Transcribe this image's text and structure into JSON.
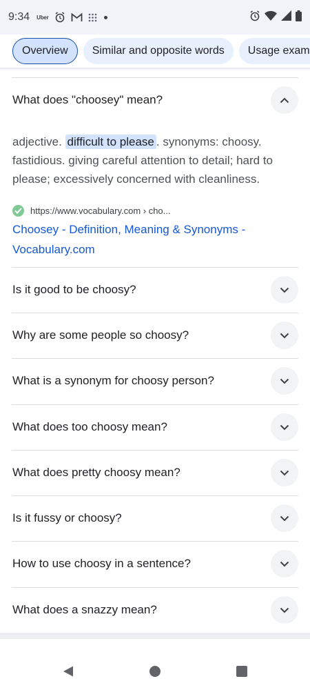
{
  "status_bar": {
    "time": "9:34",
    "app_label": "Uber"
  },
  "chips": [
    {
      "label": "Overview",
      "active": true
    },
    {
      "label": "Similar and opposite words",
      "active": false
    },
    {
      "label": "Usage examples",
      "active": false
    }
  ],
  "expanded": {
    "question": "What does \"choosey\" mean?",
    "answer_prefix": "adjective. ",
    "answer_highlight": "difficult to please",
    "answer_suffix": ". synonyms: choosy. fastidious. giving careful attention to detail; hard to please; excessively concerned with cleanliness.",
    "source_url": "https://www.vocabulary.com › cho...",
    "source_title": "Choosey - Definition, Meaning & Synonyms - Vocabulary.com"
  },
  "questions": [
    "Is it good to be choosy?",
    "Why are some people so choosy?",
    "What is a synonym for choosy person?",
    "What does too choosy mean?",
    "What does pretty choosy mean?",
    "Is it fussy or choosy?",
    "How to use choosy in a sentence?",
    "What does a snazzy mean?"
  ],
  "colors": {
    "chip_bg": "#e8f0fe",
    "link": "#1558d6",
    "highlight": "#d3e3fd"
  }
}
